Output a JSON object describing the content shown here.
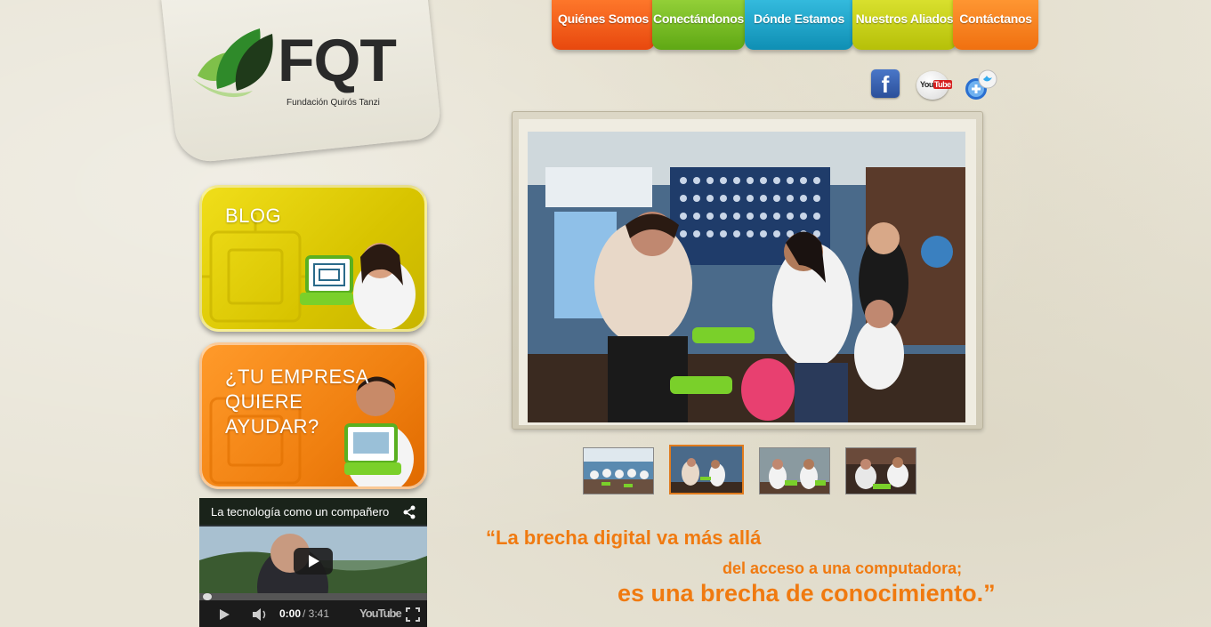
{
  "logo": {
    "mark": "FQT",
    "name": "Fundación Quirós Tanzi"
  },
  "nav": {
    "items": [
      {
        "label": "Quiénes Somos",
        "color": "#f0581a"
      },
      {
        "label": "Conectándonos",
        "color": "#7cc022"
      },
      {
        "label": "Dónde Estamos",
        "color": "#1aa4c8"
      },
      {
        "label": "Nuestros Aliados",
        "color": "#c8d21a"
      },
      {
        "label": "Contáctanos",
        "color": "#f5821e"
      }
    ]
  },
  "social": {
    "facebook_icon": "facebook-icon",
    "youtube_icon": "youtube-icon",
    "twitter_icon": "twitter-icon",
    "youtube_text_a": "You",
    "youtube_text_b": "Tube"
  },
  "banners": {
    "blog": "BLOG",
    "empresa_line1": "¿TU EMPRESA",
    "empresa_line2": "QUIERE",
    "empresa_line3": "AYUDAR?"
  },
  "video": {
    "title": "La tecnología como un compañero",
    "time_current": "0:00",
    "time_total": "/ 3:41",
    "brand": "YouTube"
  },
  "quote": {
    "line1": "“La brecha digital va más allá",
    "line2": "del acceso a una computadora;",
    "line3": "es una brecha de conocimiento.”"
  },
  "colors": {
    "accent": "#f07a10"
  }
}
